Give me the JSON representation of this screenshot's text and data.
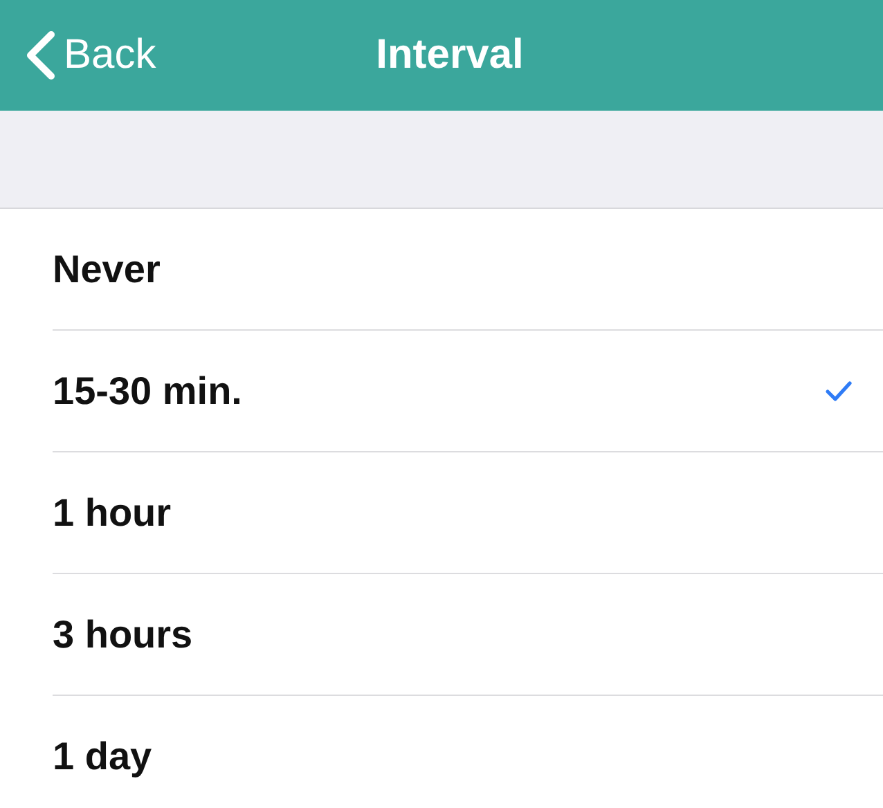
{
  "nav_bar": {
    "back": "Back",
    "title": "Interval"
  },
  "options": [
    {
      "label": "Never",
      "selected": false
    },
    {
      "label": "15-30 min.",
      "selected": true
    },
    {
      "label": "1 hour",
      "selected": false
    },
    {
      "label": "3 hours",
      "selected": false
    },
    {
      "label": "1 day",
      "selected": false
    }
  ]
}
